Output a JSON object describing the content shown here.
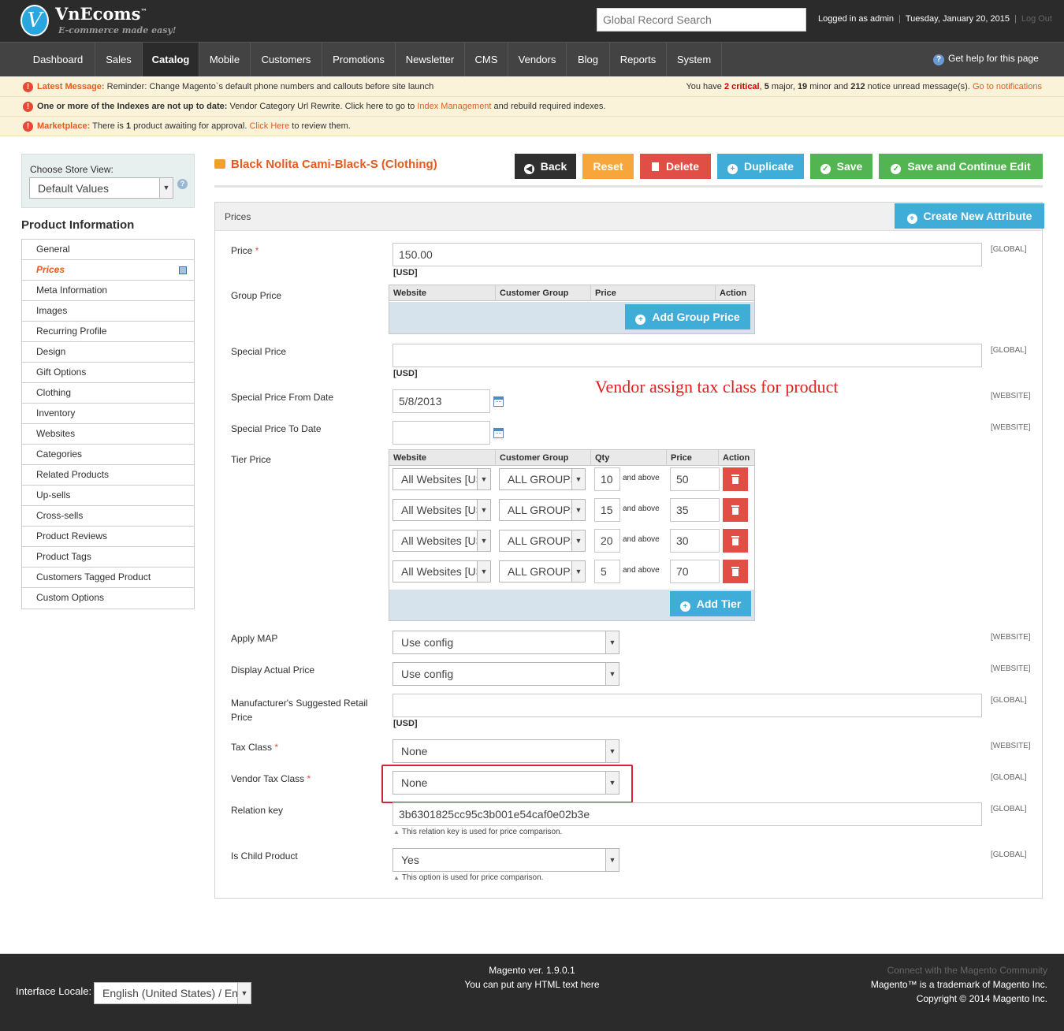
{
  "header": {
    "logo_letter": "V",
    "logo_name": "VnEcoms",
    "logo_tm": "™",
    "logo_tagline": "E-commerce made easy!",
    "search_placeholder": "Global Record Search",
    "logged_in": "Logged in as admin",
    "date": "Tuesday, January 20, 2015",
    "logout": "Log Out",
    "sep": "|"
  },
  "nav": {
    "items": [
      "Dashboard",
      "Sales",
      "Catalog",
      "Mobile",
      "Customers",
      "Promotions",
      "Newsletter",
      "CMS",
      "Vendors",
      "Blog",
      "Reports",
      "System"
    ],
    "active": "Catalog",
    "help": "Get help for this page",
    "help_icon": "?"
  },
  "messages": {
    "m1_title": "Latest Message:",
    "m1_text": " Reminder: Change Magento`s default phone numbers and callouts before site launch",
    "m1_right_a": "You have ",
    "m1_critical": "2 critical",
    "m1_right_b": ", ",
    "m1_major": "5",
    "m1_right_c": " major, ",
    "m1_minor": "19",
    "m1_right_d": " minor and ",
    "m1_notice": "212",
    "m1_right_e": " notice unread message(s). ",
    "m1_link": "Go to notifications",
    "m2_title": "One or more of the Indexes are not up to date:",
    "m2_text": " Vendor Category Url Rewrite. Click here to go to ",
    "m2_link": "Index Management",
    "m2_text2": " and rebuild required indexes.",
    "m3_title": "Marketplace:",
    "m3_text": " There is ",
    "m3_count": "1",
    "m3_text2": " product awaiting for approval. ",
    "m3_link": "Click Here",
    "m3_text3": " to review them.",
    "icon": "!"
  },
  "sidebar": {
    "store_view_label": "Choose Store View:",
    "store_view_value": "Default Values",
    "help_icon": "?",
    "title": "Product Information",
    "tabs": [
      "General",
      "Prices",
      "Meta Information",
      "Images",
      "Recurring Profile",
      "Design",
      "Gift Options",
      "Clothing",
      "Inventory",
      "Websites",
      "Categories",
      "Related Products",
      "Up-sells",
      "Cross-sells",
      "Product Reviews",
      "Product Tags",
      "Customers Tagged Product",
      "Custom Options"
    ],
    "active_tab": "Prices"
  },
  "page": {
    "title": "Black Nolita Cami-Black-S (Clothing)",
    "buttons": {
      "back": "Back",
      "reset": "Reset",
      "delete": "Delete",
      "duplicate": "Duplicate",
      "save": "Save",
      "save_continue": "Save and Continue Edit"
    }
  },
  "prices": {
    "section_title": "Prices",
    "create_attribute": "Create New Attribute",
    "price_label": "Price",
    "price_value": "150.00",
    "currency": "[USD]",
    "req": "*",
    "group_price_label": "Group Price",
    "group_price_cols": [
      "Website",
      "Customer Group",
      "Price",
      "Action"
    ],
    "add_group_price": "Add Group Price",
    "special_price_label": "Special Price",
    "special_from_label": "Special Price From Date",
    "special_from_value": "5/8/2013",
    "special_to_label": "Special Price To Date",
    "tier_price_label": "Tier Price",
    "tier_cols": [
      "Website",
      "Customer Group",
      "Qty",
      "Price",
      "Action"
    ],
    "tier_rows": [
      {
        "website": "All Websites [USD]",
        "group": "ALL GROUPS",
        "qty": "10",
        "and_above": "and above",
        "price": "50"
      },
      {
        "website": "All Websites [USD]",
        "group": "ALL GROUPS",
        "qty": "15",
        "and_above": "and above",
        "price": "35"
      },
      {
        "website": "All Websites [USD]",
        "group": "ALL GROUPS",
        "qty": "20",
        "and_above": "and above",
        "price": "30"
      },
      {
        "website": "All Websites [USD]",
        "group": "ALL GROUPS",
        "qty": "5",
        "and_above": "and above",
        "price": "70"
      }
    ],
    "add_tier": "Add Tier",
    "apply_map_label": "Apply MAP",
    "apply_map_value": "Use config",
    "display_actual_label": "Display Actual Price",
    "display_actual_value": "Use config",
    "msrp_label": "Manufacturer's Suggested Retail Price",
    "tax_class_label": "Tax Class",
    "tax_class_value": "None",
    "vendor_tax_label": "Vendor Tax Class",
    "vendor_tax_value": "None",
    "relation_key_label": "Relation key",
    "relation_key_value": "3b6301825cc95c3b001e54caf0e02b3e",
    "relation_key_note": "This relation key is used for price comparison.",
    "is_child_label": "Is Child Product",
    "is_child_value": "Yes",
    "is_child_note": "This option is used for price comparison.",
    "scope_global": "[GLOBAL]",
    "scope_website": "[WEBSITE]",
    "annotation": "Vendor assign tax class for product"
  },
  "footer": {
    "version": "Magento ver. 1.9.0.1",
    "html_text": "You can put any HTML text here",
    "community": "Connect with the Magento Community",
    "trademark": "Magento™ is a trademark of Magento Inc.",
    "copyright": "Copyright © 2014 Magento Inc.",
    "locale_label": "Interface Locale:",
    "locale_value": "English (United States) / English (United States)"
  },
  "colors": {
    "accent": "#e55b1f",
    "header_bg": "#2b2b2b",
    "nav_bg": "#434343",
    "button_green": "#53b552",
    "button_blue": "#3fadd8",
    "button_red": "#e04e45",
    "annotation": "#e02020"
  }
}
